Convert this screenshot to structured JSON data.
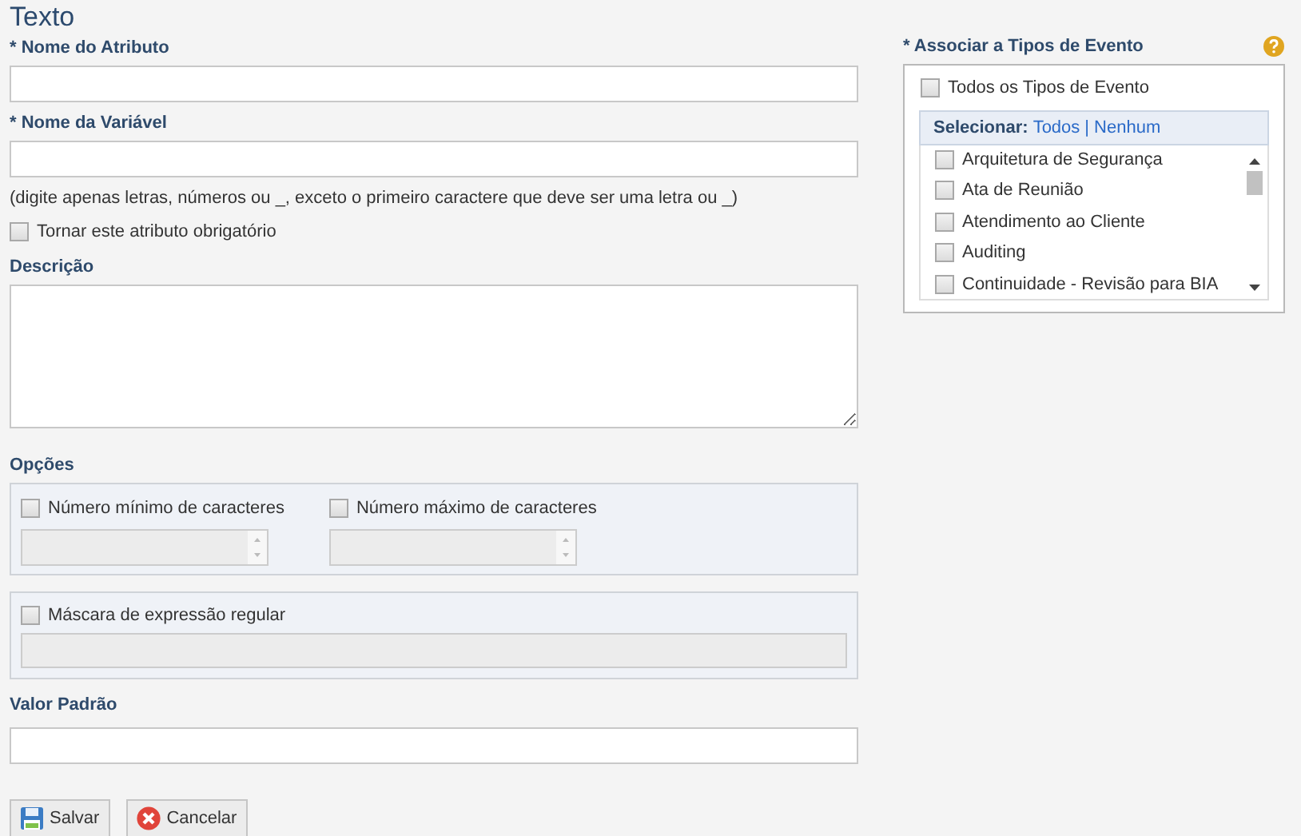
{
  "title": "Texto",
  "attribute_name": {
    "label": "* Nome do Atributo"
  },
  "variable_name": {
    "label": "* Nome da Variável",
    "hint": "(digite apenas letras, números ou _, exceto o primeiro caractere que deve ser uma letra ou _)"
  },
  "required_checkbox": {
    "label": "Tornar este atributo obrigatório",
    "checked": false
  },
  "description": {
    "label": "Descrição"
  },
  "options": {
    "label": "Opções",
    "min_chars": {
      "label": "Número mínimo de caracteres",
      "checked": false
    },
    "max_chars": {
      "label": "Número máximo de caracteres",
      "checked": false
    },
    "regex_mask": {
      "label": "Máscara de expressão regular",
      "checked": false
    }
  },
  "default_value": {
    "label": "Valor Padrão"
  },
  "buttons": [
    {
      "label": "Salvar",
      "kind": "save"
    },
    {
      "label": "Cancelar",
      "kind": "cancel"
    }
  ],
  "event_types": {
    "label": "* Associar a Tipos de Evento",
    "all": {
      "label": "Todos os Tipos de Evento",
      "checked": false
    },
    "select_label": "Selecionar:",
    "select_all": "Todos",
    "separator": "|",
    "select_none": "Nenhum",
    "items": [
      {
        "label": "Arquitetura de Segurança",
        "checked": false
      },
      {
        "label": "Ata de Reunião",
        "checked": false
      },
      {
        "label": "Atendimento ao Cliente",
        "checked": false
      },
      {
        "label": "Auditing",
        "checked": false
      },
      {
        "label": "Continuidade - Revisão para BIA",
        "checked": false
      }
    ]
  }
}
